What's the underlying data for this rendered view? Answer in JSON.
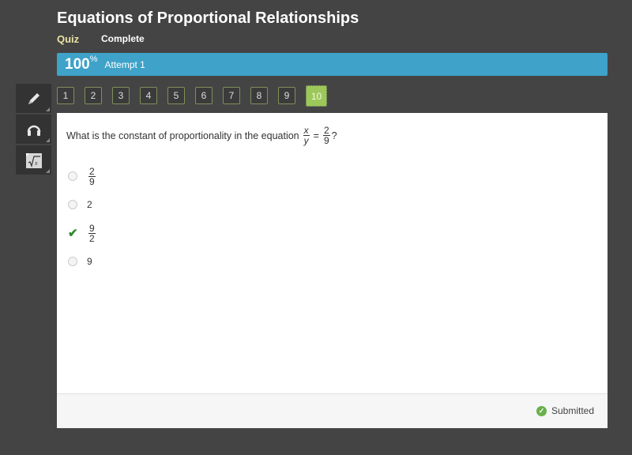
{
  "header": {
    "title": "Equations of Proportional Relationships",
    "type_label": "Quiz",
    "status_label": "Complete"
  },
  "scorebar": {
    "score": "100",
    "score_unit": "%",
    "attempt_label": "Attempt 1",
    "color": "#3ea2c9"
  },
  "tools": [
    {
      "name": "pencil-icon",
      "glyph": "✎"
    },
    {
      "name": "headphones-icon",
      "glyph": "🎧"
    },
    {
      "name": "math-formula-icon",
      "glyph": "√x"
    }
  ],
  "question_nav": {
    "items": [
      "1",
      "2",
      "3",
      "4",
      "5",
      "6",
      "7",
      "8",
      "9",
      "10"
    ],
    "active": "10",
    "active_color": "#9cc85a"
  },
  "question": {
    "text": "What is the constant of proportionality in the equation",
    "equation": {
      "lhs_num": "x",
      "lhs_den": "y",
      "eq": "=",
      "rhs_num": "2",
      "rhs_den": "9"
    },
    "end": "?"
  },
  "choices": [
    {
      "type": "fraction",
      "num": "2",
      "den": "9",
      "selected": false
    },
    {
      "type": "text",
      "value": "2",
      "selected": false
    },
    {
      "type": "fraction",
      "num": "9",
      "den": "2",
      "selected": true,
      "correct": true
    },
    {
      "type": "text",
      "value": "9",
      "selected": false
    }
  ],
  "footer": {
    "status_label": "Submitted",
    "status_icon": "check-circle-icon"
  }
}
